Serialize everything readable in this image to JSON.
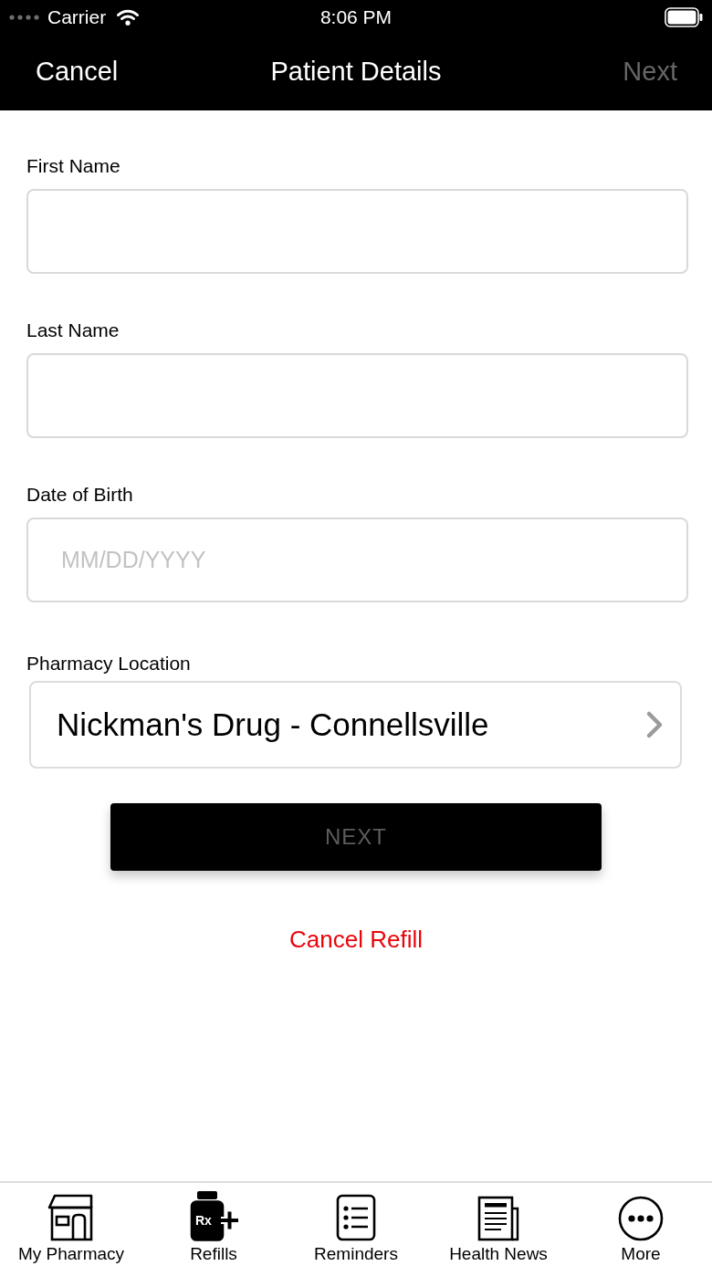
{
  "status_bar": {
    "carrier": "Carrier",
    "time": "8:06 PM"
  },
  "nav": {
    "cancel": "Cancel",
    "title": "Patient Details",
    "next": {
      "label": "Next",
      "disabled": true
    }
  },
  "form": {
    "fields": [
      {
        "kind": "text",
        "label": "First Name"
      },
      {
        "kind": "text",
        "label": "Last Name"
      },
      {
        "kind": "text",
        "label": "Date of Birth",
        "placeholder": "MM/DD/YYYY"
      },
      {
        "kind": "select",
        "label": "Pharmacy Location",
        "value": "Nickman's Drug - Connellsville"
      }
    ]
  },
  "next_button": {
    "label": "NEXT",
    "disabled": true
  },
  "cancel_link": "Cancel Refill",
  "tab_bar": [
    {
      "kind": "store",
      "label": "My Pharmacy",
      "selected": false
    },
    {
      "kind": "refills",
      "label": "Refills",
      "icon_text": "Rx",
      "selected": true
    },
    {
      "kind": "list",
      "label": "Reminders",
      "selected": false
    },
    {
      "kind": "news",
      "label": "Health News",
      "selected": false
    },
    {
      "kind": "more",
      "label": "More",
      "selected": false
    }
  ]
}
